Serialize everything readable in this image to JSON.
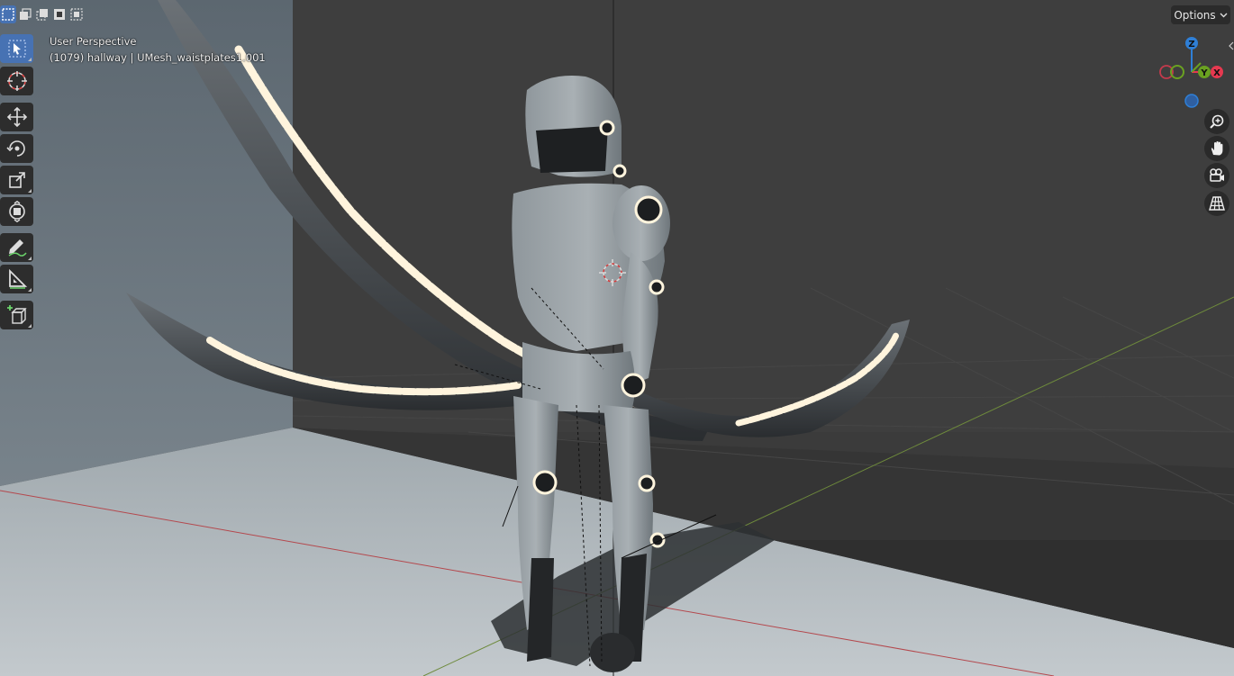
{
  "viewport": {
    "title": "User Perspective",
    "info": "(1079) hallway | UMesh_waistplates1.001",
    "options_label": "Options"
  },
  "select_modes": [
    {
      "name": "mode-set-icon",
      "active": true
    },
    {
      "name": "mode-extend-icon",
      "active": false
    },
    {
      "name": "mode-subtract-icon",
      "active": false
    },
    {
      "name": "mode-invert-icon",
      "active": false
    },
    {
      "name": "mode-intersect-icon",
      "active": false
    }
  ],
  "tools": [
    {
      "name": "select-box-tool",
      "icon": "cursor-arrow-icon",
      "active": true
    },
    {
      "name": "cursor-tool",
      "icon": "3d-cursor-icon",
      "active": false
    },
    {
      "name": "move-tool",
      "icon": "move-arrows-icon",
      "active": false
    },
    {
      "name": "rotate-tool",
      "icon": "rotate-icon",
      "active": false
    },
    {
      "name": "scale-tool",
      "icon": "scale-icon",
      "active": false
    },
    {
      "name": "transform-tool",
      "icon": "transform-icon",
      "active": false
    },
    {
      "name": "annotate-tool",
      "icon": "pencil-icon",
      "active": false
    },
    {
      "name": "measure-tool",
      "icon": "ruler-icon",
      "active": false
    },
    {
      "name": "add-cube-tool",
      "icon": "add-cube-icon",
      "active": false
    }
  ],
  "gizmo": {
    "z_label": "Z",
    "y_label": "Y",
    "x_label": "X",
    "z_color": "#2f7fd6",
    "y_color": "#6aa121",
    "x_color": "#e63950"
  },
  "nav_buttons": [
    {
      "name": "zoom-view-button",
      "icon": "magnifier-plus-icon"
    },
    {
      "name": "pan-view-button",
      "icon": "hand-icon"
    },
    {
      "name": "camera-view-button",
      "icon": "camera-icon"
    },
    {
      "name": "perspective-toggle-button",
      "icon": "grid-icon"
    }
  ],
  "colors": {
    "accent": "#4772b3",
    "toolbar_bg": "#2d2d2d",
    "glow": "#fff5e0"
  }
}
